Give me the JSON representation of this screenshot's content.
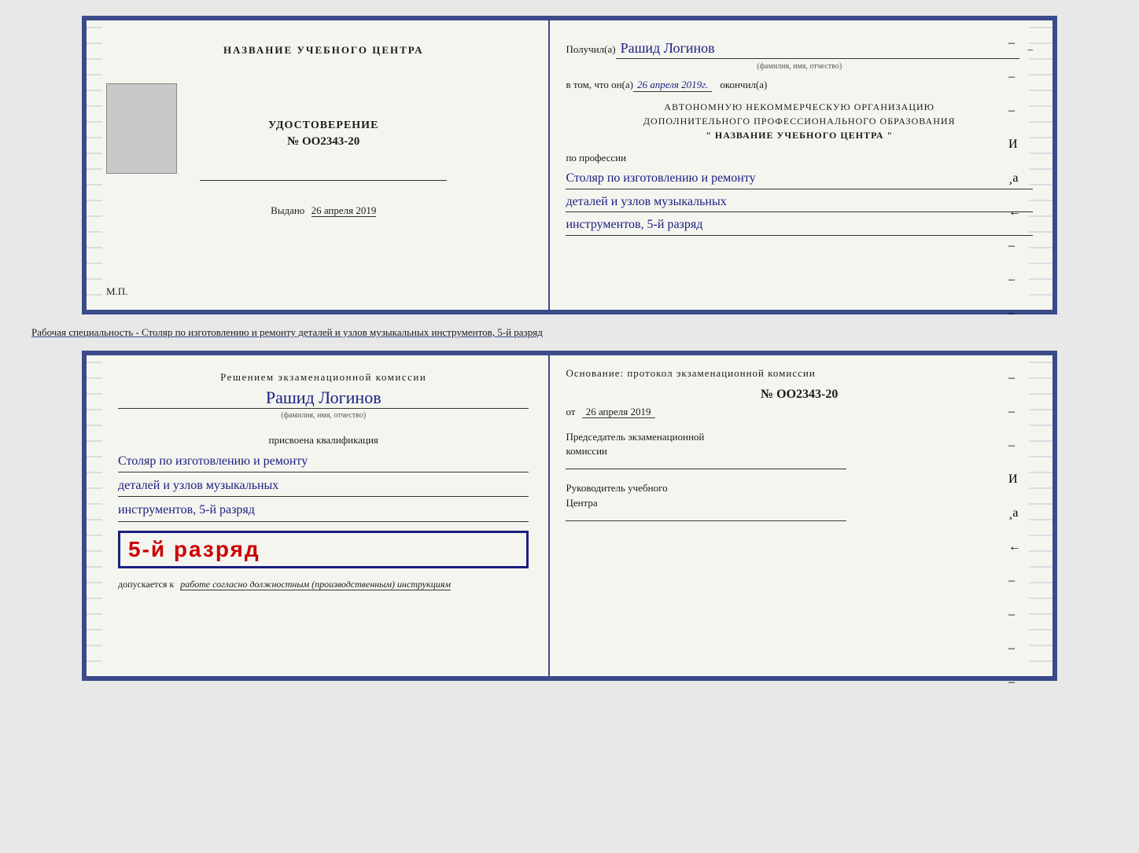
{
  "page": {
    "background_color": "#e8e8e8"
  },
  "top_doc": {
    "left": {
      "center_title": "НАЗВАНИЕ УЧЕБНОГО ЦЕНТРА",
      "udostoverenie_label": "УДОСТОВЕРЕНИЕ",
      "number": "№ OO2343-20",
      "vydano_label": "Выдано",
      "vydano_date": "26 апреля 2019",
      "mp_label": "М.П."
    },
    "right": {
      "poluchil_label": "Получил(а)",
      "recipient_name": "Рашид Логинов",
      "fio_subtitle": "(фамилия, имя, отчество)",
      "vtom_label": "в том, что он(а)",
      "vtom_date": "26 апреля 2019г.",
      "okonchil_label": "окончил(а)",
      "org_line1": "АВТОНОМНУЮ НЕКОММЕРЧЕСКУЮ ОРГАНИЗАЦИЮ",
      "org_line2": "ДОПОЛНИТЕЛЬНОГО ПРОФЕССИОНАЛЬНОГО ОБРАЗОВАНИЯ",
      "org_line3": "\" НАЗВАНИЕ УЧЕБНОГО ЦЕНТРА \"",
      "po_professii": "по профессии",
      "profession_line1": "Столяр по изготовлению и ремонту",
      "profession_line2": "деталей и узлов музыкальных",
      "profession_line3": "инструментов, 5-й разряд"
    }
  },
  "between_label": "Рабочая специальность - Столяр по изготовлению и ремонту деталей и узлов музыкальных инструментов, 5-й разряд",
  "bottom_doc": {
    "left": {
      "resheniem_text": "Решением экзаменационной комиссии",
      "name_handwritten": "Рашид Логинов",
      "fio_subtitle": "(фамилия, имя, отчество)",
      "prisvoena_text": "присвоена квалификация",
      "qual_line1": "Столяр по изготовлению и ремонту",
      "qual_line2": "деталей и узлов музыкальных",
      "qual_line3": "инструментов, 5-й разряд",
      "grade_text": "5-й разряд",
      "dopusk_prefix": "допускается к",
      "dopusk_italic": "работе согласно должностным (производственным) инструкциям"
    },
    "right": {
      "osnovanie_text": "Основание: протокол экзаменационной комиссии",
      "protocol_number": "№ OO2343-20",
      "ot_label": "от",
      "ot_date": "26 апреля 2019",
      "predsedatel_line1": "Председатель экзаменационной",
      "predsedatel_line2": "комиссии",
      "rukovoditel_line1": "Руководитель учебного",
      "rukovoditel_line2": "Центра",
      "dashes": [
        "–",
        "–",
        "–",
        "И",
        "¸а",
        "←",
        "–",
        "–",
        "–",
        "–"
      ]
    }
  }
}
